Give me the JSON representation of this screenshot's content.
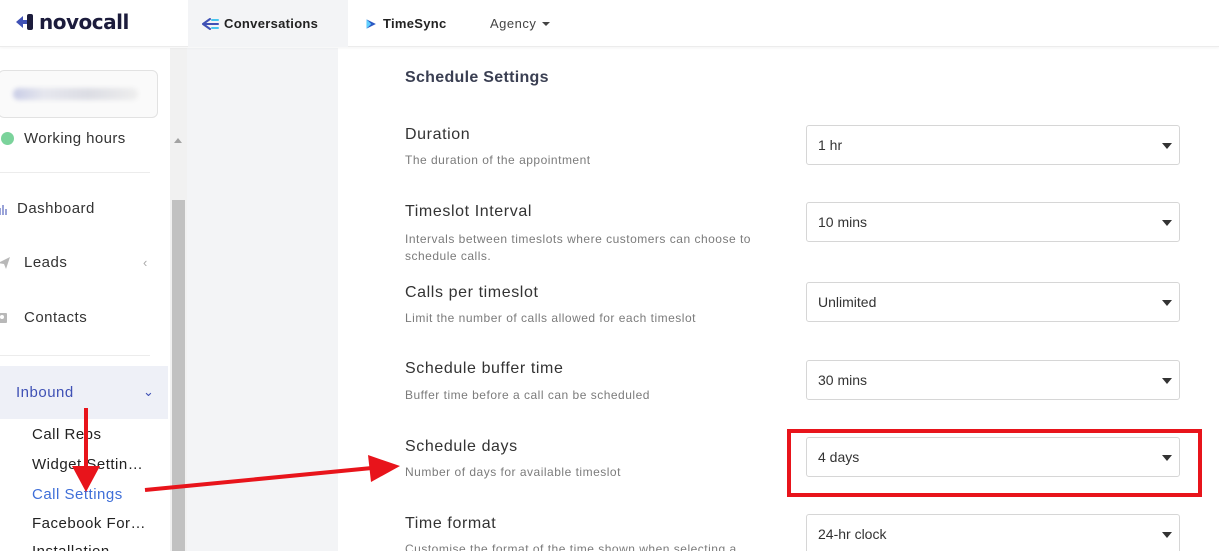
{
  "app": {
    "logo_text": "novocall",
    "colors": {
      "brand": "#3f51b5",
      "annotation": "#e8141b",
      "status_online": "#7bd39b"
    }
  },
  "topnav": {
    "tabs": [
      {
        "label": "Conversations",
        "icon": "conversations-icon"
      },
      {
        "label": "TimeSync",
        "icon": "timesync-icon"
      },
      {
        "label": "Agency",
        "icon": "chevron-down-icon"
      }
    ]
  },
  "sidebar": {
    "status_label": "Working hours",
    "items": [
      {
        "label": "Dashboard",
        "icon": "bar-chart-icon"
      },
      {
        "label": "Leads",
        "icon": "send-icon"
      },
      {
        "label": "Contacts",
        "icon": "contact-card-icon"
      },
      {
        "label": "Inbound",
        "icon": "plane-icon"
      }
    ],
    "inbound_sub": [
      {
        "label": "Call Reps"
      },
      {
        "label": "Widget Settin…"
      },
      {
        "label": "Call Settings"
      },
      {
        "label": "Facebook For…"
      },
      {
        "label": "Installation"
      }
    ]
  },
  "main": {
    "section_title": "Schedule Settings",
    "settings": [
      {
        "title": "Duration",
        "description": "The duration of the appointment",
        "value": "1 hr"
      },
      {
        "title": "Timeslot Interval",
        "description": "Intervals between timeslots where customers can choose to schedule calls.",
        "value": "10 mins"
      },
      {
        "title": "Calls per timeslot",
        "description": "Limit the number of calls allowed for each timeslot",
        "value": "Unlimited"
      },
      {
        "title": "Schedule buffer time",
        "description": "Buffer time before a call can be scheduled",
        "value": "30 mins"
      },
      {
        "title": "Schedule days",
        "description": "Number of days for available timeslot",
        "value": "4 days"
      },
      {
        "title": "Time format",
        "description": "Customise the format of the time shown when selecting a",
        "value": "24-hr clock"
      }
    ]
  }
}
